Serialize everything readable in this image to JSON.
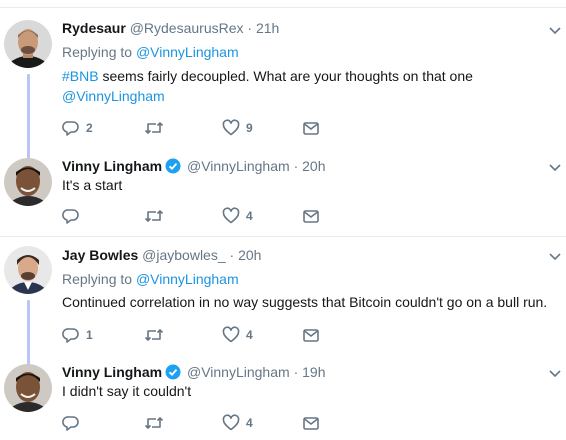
{
  "tweets": [
    {
      "name": "Rydesaur",
      "handle": "@RydesaurusRex",
      "dot": "·",
      "time": "21h",
      "verified": false,
      "reply_prefix": "Replying to",
      "reply_mention": "@VinnyLingham",
      "text_hashtag": "#BNB",
      "text_body": " seems fairly decoupled.  What are your thoughts on that one",
      "text_mention": "@VinnyLingham",
      "replies": "2",
      "retweets": "",
      "likes": "9"
    },
    {
      "name": "Vinny Lingham",
      "handle": "@VinnyLingham",
      "dot": "·",
      "time": "20h",
      "verified": true,
      "text": "It's a start",
      "replies": "",
      "retweets": "",
      "likes": "4"
    },
    {
      "name": "Jay Bowles",
      "handle": "@jaybowles_",
      "dot": "·",
      "time": "20h",
      "verified": false,
      "reply_prefix": "Replying to",
      "reply_mention": "@VinnyLingham",
      "text": "Continued correlation in no way suggests that Bitcoin couldn't go on a bull run.",
      "replies": "1",
      "retweets": "",
      "likes": "4"
    },
    {
      "name": "Vinny Lingham",
      "handle": "@VinnyLingham",
      "dot": "·",
      "time": "19h",
      "verified": true,
      "text": "I didn't say it couldn't",
      "replies": "",
      "retweets": "",
      "likes": "4"
    }
  ],
  "icons": {
    "reply": "reply-icon",
    "retweet": "retweet-icon",
    "like": "heart-icon",
    "message": "envelope-icon",
    "caret": "chevron-down-icon",
    "verified": "verified-badge-icon"
  },
  "colors": {
    "link": "#1b95e0",
    "secondary_text": "#657786",
    "thread_line": "#bac5f3",
    "verified": "#1da1f2"
  }
}
